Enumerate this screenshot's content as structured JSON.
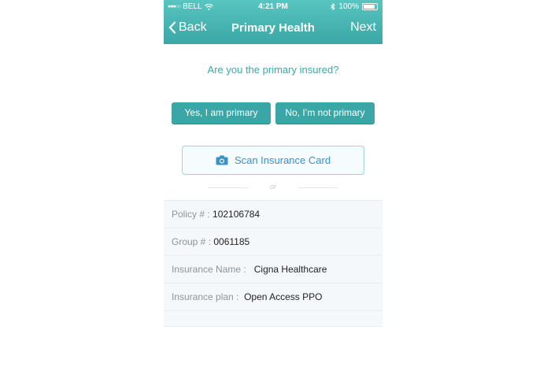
{
  "status_bar": {
    "carrier": "BELL",
    "time": "4:21 PM",
    "battery": "100%"
  },
  "nav": {
    "back_label": "Back",
    "title": "Primary Health",
    "next_label": "Next"
  },
  "question": "Are you the primary insured?",
  "buttons": {
    "yes": "Yes, I am primary",
    "no": "No, I’m not primary"
  },
  "scan": {
    "label": "Scan Insurance Card"
  },
  "divider_text": "or",
  "fields": [
    {
      "label": "Policy # :",
      "value": "102106784"
    },
    {
      "label": "Group # :",
      "value": "0061185"
    },
    {
      "label": "Insurance Name :",
      "value": "Cigna Healthcare"
    },
    {
      "label": "Insurance plan :",
      "value": "Open Access PPO"
    }
  ],
  "colors": {
    "accent": "#3aa7a6",
    "scan_text": "#3a93c6"
  }
}
